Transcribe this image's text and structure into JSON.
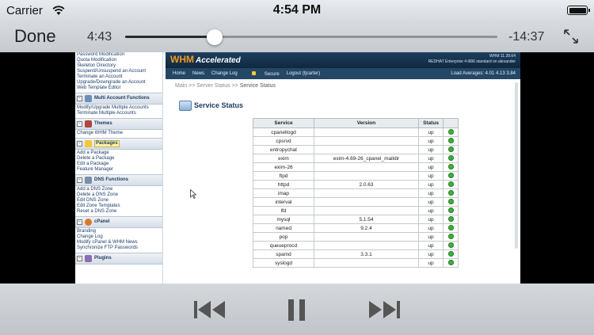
{
  "status_bar": {
    "carrier": "Carrier",
    "time": "4:54 PM"
  },
  "player": {
    "done_label": "Done",
    "elapsed": "4:43",
    "remaining": "-14:37",
    "progress_fraction": 0.24
  },
  "video": {
    "whm": {
      "logo": "WHM",
      "logo_accent": "Accelerated",
      "version_line1": "WHM 11.28.64",
      "version_line2": "REDHAT Enterprise 4 i686 standard on alexander",
      "nav": [
        "Home",
        "News",
        "Change Log",
        "Secure",
        "Logout (tjcarter)"
      ],
      "load_averages": "Load Averages: 4.01 4.13 3.84",
      "breadcrumb_prefix": "Main >> Server Status >> ",
      "breadcrumb_current": "Service Status",
      "section_title": "Service Status",
      "table_headers": [
        "Service",
        "Version",
        "Status"
      ],
      "services": [
        {
          "service": "cpanellogd",
          "version": "",
          "status": "up"
        },
        {
          "service": "cpsrvd",
          "version": "",
          "status": "up"
        },
        {
          "service": "entropychat",
          "version": "",
          "status": "up"
        },
        {
          "service": "exim",
          "version": "exim-4.69-26_cpanel_maildir",
          "status": "up"
        },
        {
          "service": "exim-26",
          "version": "",
          "status": "up"
        },
        {
          "service": "ftpd",
          "version": "",
          "status": "up"
        },
        {
          "service": "httpd",
          "version": "2.0.63",
          "status": "up"
        },
        {
          "service": "imap",
          "version": "",
          "status": "up"
        },
        {
          "service": "interval",
          "version": "",
          "status": "up"
        },
        {
          "service": "lfd",
          "version": "",
          "status": "up"
        },
        {
          "service": "mysql",
          "version": "5.1.54",
          "status": "up"
        },
        {
          "service": "named",
          "version": "9.2.4",
          "status": "up"
        },
        {
          "service": "pop",
          "version": "",
          "status": "up"
        },
        {
          "service": "queueprocd",
          "version": "",
          "status": "up"
        },
        {
          "service": "spamd",
          "version": "3.3.1",
          "status": "up"
        },
        {
          "service": "syslogd",
          "version": "",
          "status": "up"
        }
      ],
      "sidebar": {
        "top_links": [
          "Password Modification",
          "Quota Modification",
          "Skeleton Directory",
          "Suspend/Unsuspend an Account",
          "Terminate an Account",
          "Upgrade/Downgrade an Account",
          "Web Template Editor"
        ],
        "multi_account": {
          "title": "Multi Account Functions",
          "links": [
            "Modify/Upgrade Multiple Accounts",
            "Terminate Multiple Accounts"
          ]
        },
        "themes": {
          "title": "Themes",
          "links": [
            "Change WHM Theme"
          ]
        },
        "packages": {
          "title": "Packages",
          "links": [
            "Add a Package",
            "Delete a Package",
            "Edit a Package",
            "Feature Manager"
          ]
        },
        "dns": {
          "title": "DNS Functions",
          "links": [
            "Add a DNS Zone",
            "Delete a DNS Zone",
            "Edit DNS Zone",
            "Edit Zone Templates",
            "Reset a DNS Zone"
          ]
        },
        "cpanel": {
          "title": "cPanel",
          "links": [
            "Branding",
            "Change Log",
            "Modify cPanel & WHM News",
            "Synchronize FTP Passwords"
          ]
        },
        "plugins": {
          "title": "Plugins"
        }
      }
    }
  },
  "colors": {
    "whm_header": "#1d3f5f",
    "whm_logo": "#f39a1b",
    "status_ok": "#3fae3f",
    "control_bar": "#c7cbcf"
  },
  "icons": [
    "wifi-icon",
    "battery-icon",
    "fullscreen-icon",
    "rewind-icon",
    "pause-icon",
    "fast-forward-icon",
    "lock-icon"
  ]
}
